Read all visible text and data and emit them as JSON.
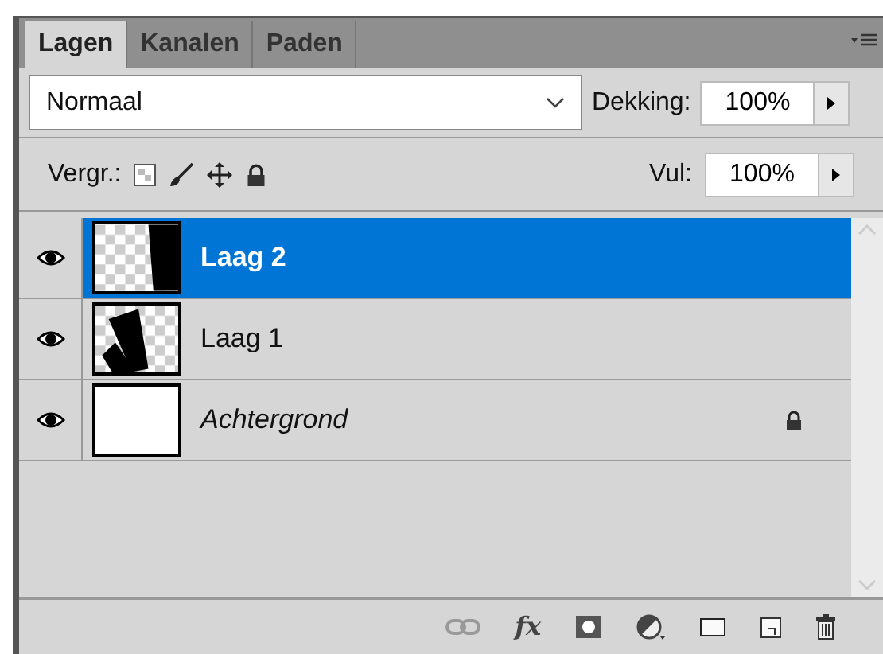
{
  "tabs": [
    {
      "label": "Lagen",
      "selected": true
    },
    {
      "label": "Kanalen",
      "selected": false
    },
    {
      "label": "Paden",
      "selected": false
    }
  ],
  "blend_mode": {
    "value": "Normaal"
  },
  "opacity": {
    "label": "Dekking:",
    "value": "100%"
  },
  "lock": {
    "label": "Vergr.:"
  },
  "fill": {
    "label": "Vul:",
    "value": "100%"
  },
  "layers": [
    {
      "name": "Laag 2",
      "selected": true,
      "visible": true,
      "locked": false,
      "kind": "layer",
      "thumbnail": {
        "kind": "bar"
      }
    },
    {
      "name": "Laag 1",
      "selected": false,
      "visible": true,
      "locked": false,
      "kind": "layer",
      "thumbnail": {
        "kind": "tilted"
      }
    },
    {
      "name": "Achtergrond",
      "selected": false,
      "visible": true,
      "locked": true,
      "kind": "background",
      "thumbnail": {
        "kind": "white"
      }
    }
  ],
  "toolbar": {
    "effects_label": "fx"
  }
}
